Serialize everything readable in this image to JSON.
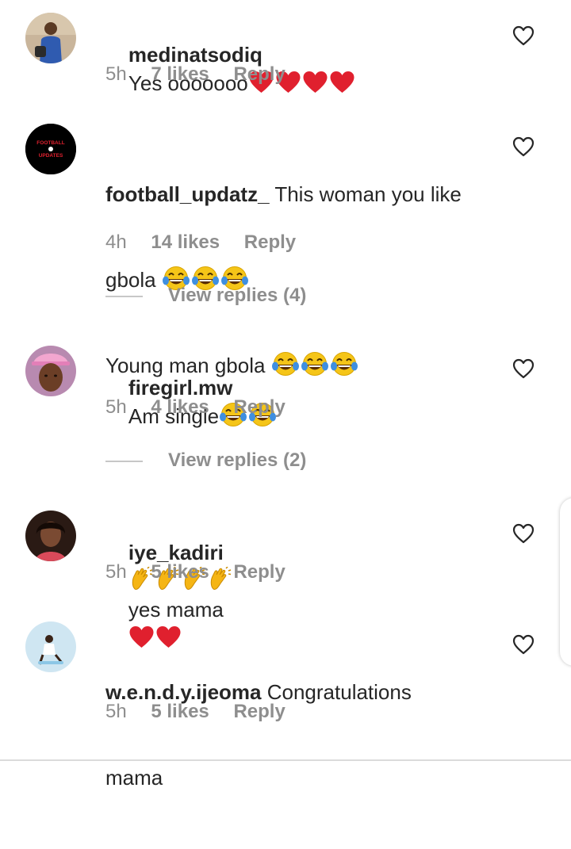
{
  "comments": [
    {
      "username": "medinatsodiq",
      "lines": [
        "Yes ooooooo"
      ],
      "emoji_after": [
        "heart",
        "heart",
        "heart",
        "heart"
      ],
      "time": "5h",
      "likes": "7 likes",
      "reply": "Reply",
      "avatar_icon": "profile-photo-woman-blue-dress"
    },
    {
      "username": "football_updatz_",
      "line1": "This woman you like",
      "line2": "gbola",
      "line3": "Young man gbola",
      "time": "4h",
      "likes": "14 likes",
      "reply": "Reply",
      "avatar_text_top": "FOOTBALL",
      "avatar_text_bottom": "UPDATES",
      "view_replies": "View replies (4)"
    },
    {
      "username": "firegirl.mw",
      "text": "Am single",
      "time": "5h",
      "likes": "4 likes",
      "reply": "Reply",
      "avatar_icon": "profile-photo-woman-pink-cap",
      "view_replies": "View replies (2)"
    },
    {
      "username": "iye_kadiri",
      "text": "yes mama",
      "time": "5h",
      "likes": "5 likes",
      "reply": "Reply",
      "avatar_icon": "profile-photo-woman-dark"
    },
    {
      "username": "w.e.n.d.y.ijeoma",
      "line1": "Congratulations",
      "line2": "mama",
      "time": "5h",
      "likes": "5 likes",
      "reply": "Reply",
      "avatar_icon": "profile-photo-woman-light-blue"
    }
  ],
  "icons": {
    "like": "heart-outline-icon",
    "emoji_heart": "red-heart-emoji",
    "emoji_laugh": "tears-of-joy-emoji",
    "emoji_clap": "clapping-hands-emoji"
  },
  "colors": {
    "text": "#262626",
    "secondary": "#8e8e8e",
    "heart_emoji": "#e0202e",
    "laugh_emoji": "#f5c518"
  }
}
